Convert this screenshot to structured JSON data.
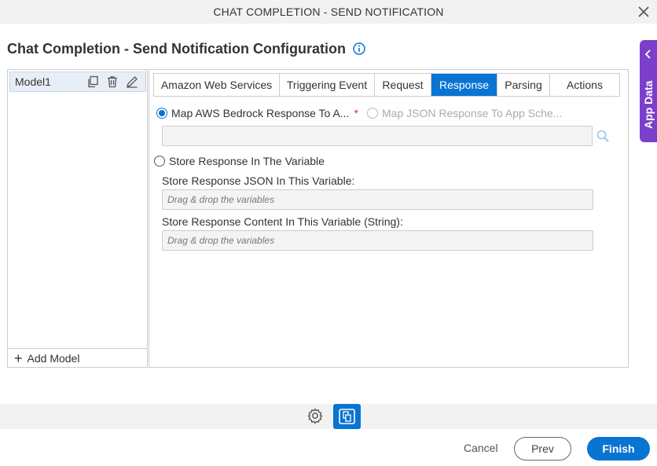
{
  "dialog": {
    "title": "CHAT COMPLETION - SEND NOTIFICATION"
  },
  "config": {
    "heading": "Chat Completion - Send Notification Configuration"
  },
  "models": {
    "items": [
      {
        "label": "Model1"
      }
    ],
    "add_label": "Add Model"
  },
  "tabs": [
    {
      "label": "Amazon Web Services"
    },
    {
      "label": "Triggering Event"
    },
    {
      "label": "Request"
    },
    {
      "label": "Response"
    },
    {
      "label": "Parsing"
    },
    {
      "label": "Actions"
    }
  ],
  "active_tab": "Response",
  "response": {
    "map_aws_label": "Map AWS Bedrock Response To A...",
    "required_mark": "*",
    "map_json_label": "Map JSON Response To App Sche...",
    "map_aws_selected": true,
    "store_var_label": "Store Response In The Variable",
    "json_var_label": "Store Response JSON In This Variable:",
    "json_var_placeholder": "Drag & drop the variables",
    "content_var_label": "Store Response Content In This Variable (String):",
    "content_var_placeholder": "Drag & drop the variables"
  },
  "side_panel": {
    "label": "App Data"
  },
  "footer": {
    "cancel": "Cancel",
    "prev": "Prev",
    "finish": "Finish"
  },
  "colors": {
    "accent": "#0a74d3",
    "app_data": "#7b3fcb"
  }
}
